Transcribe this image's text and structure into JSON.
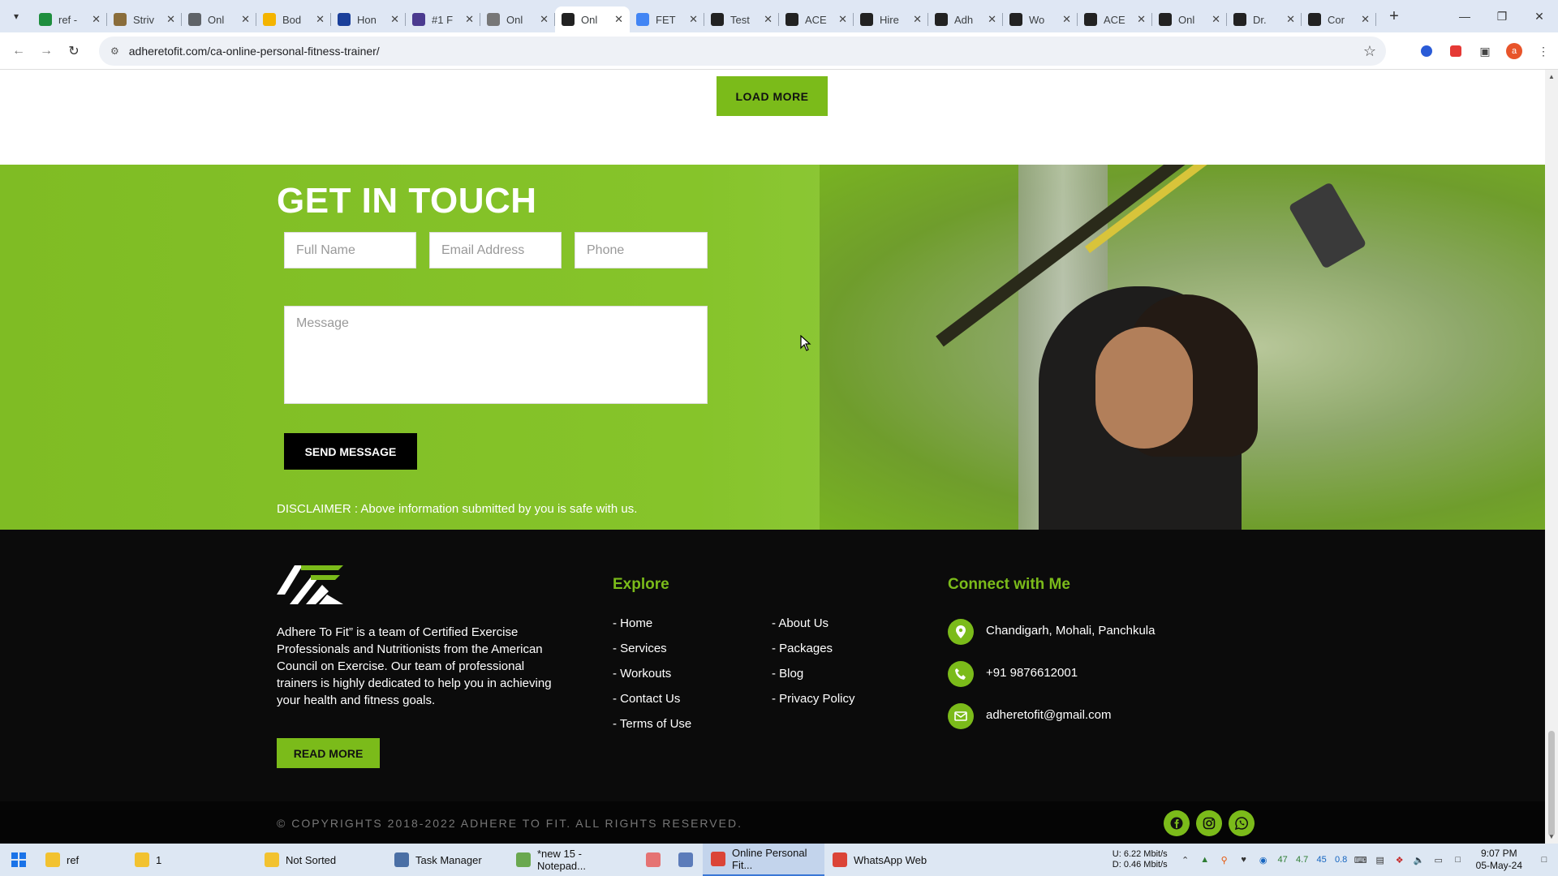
{
  "browser": {
    "tabs": [
      {
        "label": "ref -",
        "color": "#1e8e3e"
      },
      {
        "label": "Striv",
        "color": "#8a6d3b"
      },
      {
        "label": "Onl",
        "color": "#5f6368"
      },
      {
        "label": "Bod",
        "color": "#f4b400"
      },
      {
        "label": "Hon",
        "color": "#1a3f9a"
      },
      {
        "label": "#1 F",
        "color": "#4b3a8f"
      },
      {
        "label": "Onl",
        "color": "#777777"
      },
      {
        "label": "Onl",
        "color": "#222222",
        "active": true
      },
      {
        "label": "FET",
        "color": "#4285f4"
      },
      {
        "label": "Test",
        "color": "#222222"
      },
      {
        "label": "ACE",
        "color": "#222222"
      },
      {
        "label": "Hire",
        "color": "#222222"
      },
      {
        "label": "Adh",
        "color": "#222222"
      },
      {
        "label": "Wo",
        "color": "#222222"
      },
      {
        "label": "ACE",
        "color": "#222222"
      },
      {
        "label": "Onl",
        "color": "#222222"
      },
      {
        "label": "Dr.",
        "color": "#222222"
      },
      {
        "label": "Cor",
        "color": "#222222"
      }
    ],
    "url": "adheretofit.com/ca-online-personal-fitness-trainer/",
    "profile_initial": "a"
  },
  "page": {
    "load_more": "LOAD MORE",
    "get_in_touch": {
      "title": "GET IN TOUCH",
      "full_name_placeholder": "Full Name",
      "email_placeholder": "Email Address",
      "phone_placeholder": "Phone",
      "message_placeholder": "Message",
      "send_label": "SEND MESSAGE",
      "disclaimer": "DISCLAIMER : Above information submitted by you is safe with us."
    },
    "footer": {
      "about_text": "Adhere To Fit” is a team of Certified Exercise Professionals and Nutritionists from the American Council on Exercise. Our team of professional trainers is highly dedicated to help you in achieving your health and fitness goals.",
      "read_more": "READ MORE",
      "explore_heading": "Explore",
      "explore_col1": [
        "- Home",
        "- Services",
        "- Workouts",
        "- Contact Us",
        "- Terms of Use"
      ],
      "explore_col2": [
        "- About Us",
        "- Packages",
        "- Blog",
        "- Privacy Policy"
      ],
      "connect_heading": "Connect with Me",
      "location": "Chandigarh, Mohali, Panchkula",
      "phone": "+91 9876612001",
      "email": "adheretofit@gmail.com",
      "copyright": "© COPYRIGHTS 2018-2022 ADHERE TO FIT. ALL RIGHTS RESERVED."
    },
    "accent_color": "#7bbb1a"
  },
  "taskbar": {
    "items": [
      {
        "label": "ref",
        "icon": "folder-icon"
      },
      {
        "label": "1",
        "icon": "folder-icon"
      },
      {
        "label": "Not Sorted",
        "icon": "folder-icon"
      },
      {
        "label": "Task Manager",
        "icon": "task-manager-icon"
      },
      {
        "label": "*new 15 - Notepad...",
        "icon": "notepad-icon"
      },
      {
        "label": "",
        "icon": "app-icon"
      },
      {
        "label": "",
        "icon": "document-icon"
      },
      {
        "label": "Online Personal Fit...",
        "icon": "chrome-icon",
        "active": true
      },
      {
        "label": "WhatsApp Web",
        "icon": "chrome-icon"
      }
    ],
    "net_up": "U:",
    "net_up_val": "6.22 Mbit/s",
    "net_down": "D:",
    "net_down_val": "0.46 Mbit/s",
    "tray_numbers": [
      "47",
      "4.7",
      "45",
      "0.8"
    ],
    "time": "9:07 PM",
    "date": "05-May-24"
  }
}
